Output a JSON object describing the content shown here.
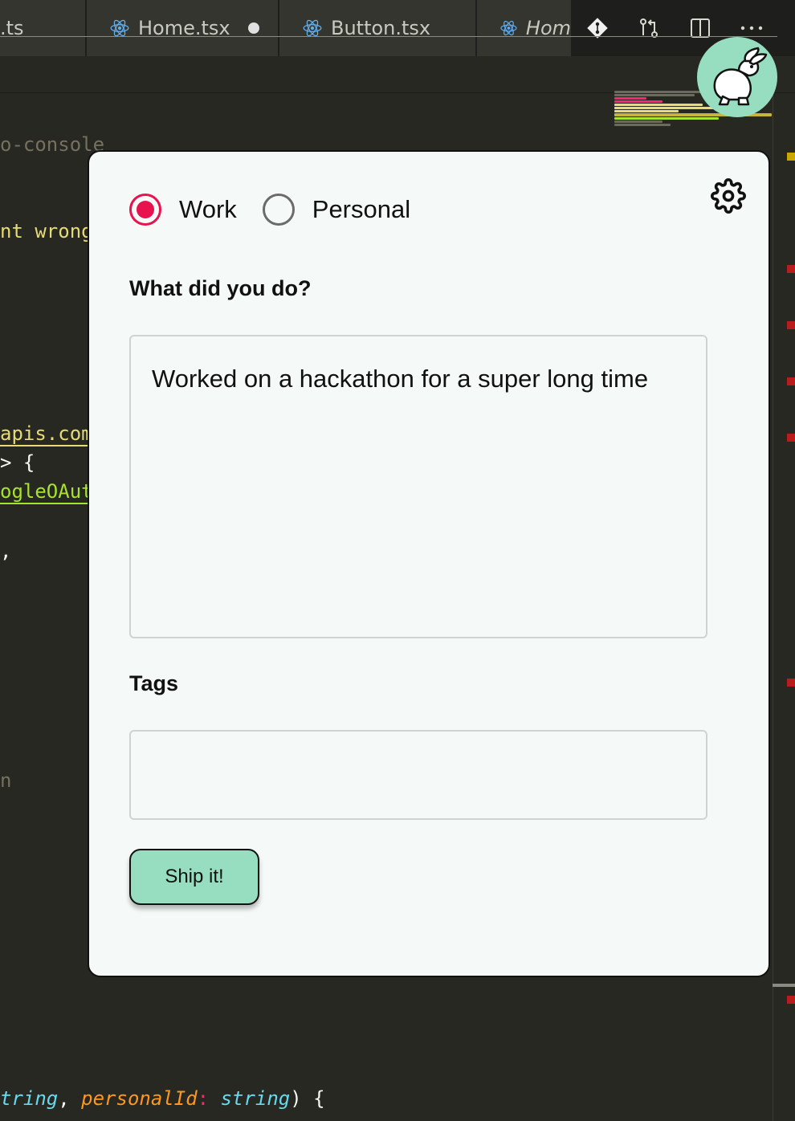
{
  "editor": {
    "tabs": [
      {
        "label": ".ts",
        "icon": "none"
      },
      {
        "label": "Home.tsx",
        "icon": "react-icon",
        "modified": true
      },
      {
        "label": "Button.tsx",
        "icon": "react-icon"
      },
      {
        "label": "Hom",
        "icon": "react-icon",
        "italic": true
      }
    ],
    "actions": [
      "git-icon",
      "compare-icon",
      "split-editor-icon",
      "more-icon"
    ],
    "code_fragments": [
      {
        "text": "o-console",
        "color": "#75715e"
      },
      {
        "text": "nt wrong",
        "color": "#e6db74"
      },
      {
        "text": "apis.com",
        "color": "#e6db74"
      },
      {
        "text": "> {",
        "color": "#f8f8f2"
      },
      {
        "text": "ogleOAut",
        "color": "#a6e22e"
      },
      {
        "text": ",",
        "color": "#f8f8f2"
      },
      {
        "text": "n",
        "color": "#75715e"
      }
    ],
    "bottom_line": {
      "type1": "tring",
      "comma": ", ",
      "param": "personalId",
      "colon": ": ",
      "type2": "string",
      "end": ") {"
    }
  },
  "avatar_icon": "rabbit-icon",
  "form": {
    "options": [
      {
        "label": "Work",
        "checked": true
      },
      {
        "label": "Personal",
        "checked": false
      }
    ],
    "settings_icon": "gear-icon",
    "question_label": "What did you do?",
    "activity_text": "Worked on a hackathon for a super long time",
    "tags_label": "Tags",
    "tags_value": "",
    "submit_label": "Ship it!"
  },
  "colors": {
    "accent": "#e8124f",
    "brand": "#97ddc0",
    "card_bg": "#f5faf8",
    "editor_bg": "#272822"
  }
}
